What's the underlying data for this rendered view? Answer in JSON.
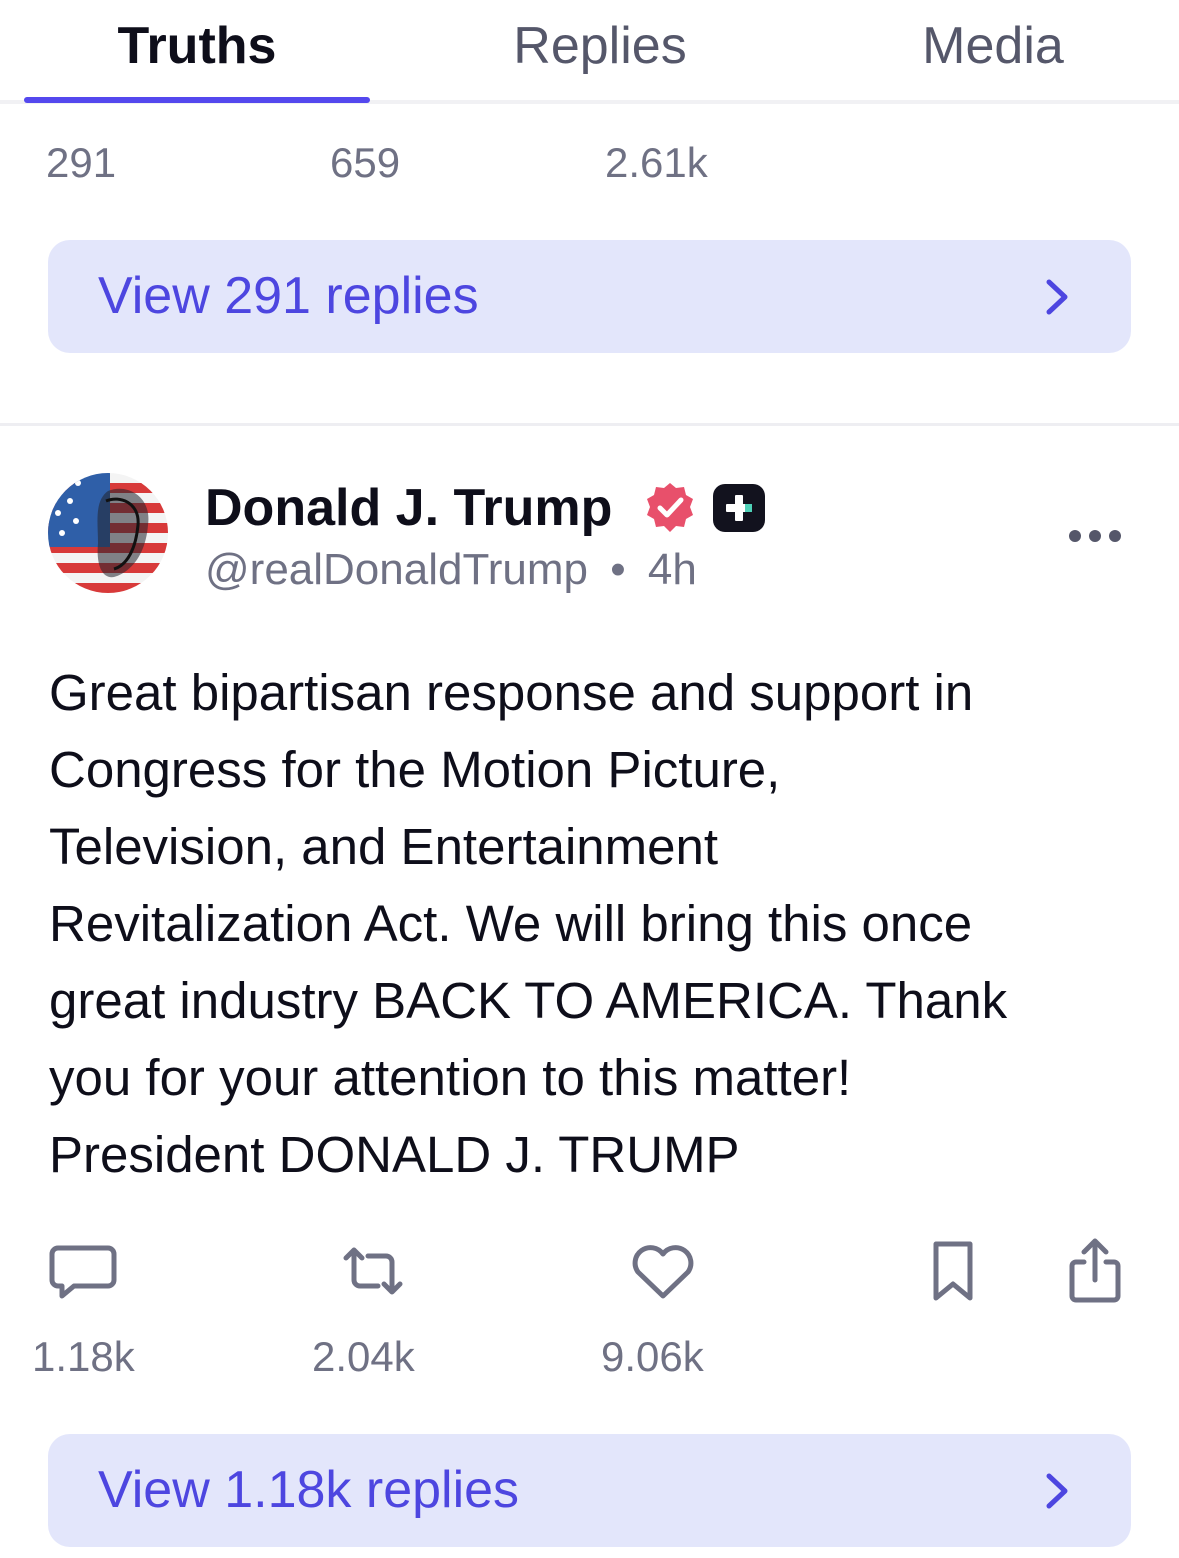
{
  "tabs": {
    "items": [
      {
        "label": "Truths",
        "active": true
      },
      {
        "label": "Replies",
        "active": false
      },
      {
        "label": "Media",
        "active": false
      }
    ],
    "accent_color": "#5448ee"
  },
  "previous_post": {
    "counts": [
      "291",
      "659",
      "2.61k"
    ],
    "view_replies_label": "View 291 replies"
  },
  "post": {
    "author": {
      "display_name": "Donald J. Trump",
      "handle": "@realDonaldTrump",
      "separator": "•",
      "time_ago": "4h",
      "verified_icon": "verified-badge-icon",
      "plus_icon": "truth-plus-icon"
    },
    "body": "Great bipartisan response and support in\nCongress for the Motion Picture,\nTelevision, and Entertainment\nRevitalization Act. We will bring this once\ngreat industry BACK TO AMERICA. Thank\nyou for your attention to this matter!\nPresident DONALD J. TRUMP",
    "actions": {
      "reply_count": "1.18k",
      "retruth_count": "2.04k",
      "like_count": "9.06k",
      "icons": [
        "reply-icon",
        "retruth-icon",
        "like-icon",
        "bookmark-icon",
        "share-icon"
      ]
    },
    "view_replies_label": "View 1.18k replies"
  },
  "colors": {
    "accent": "#5448ee",
    "reply_bar_bg": "#e3e6fb",
    "reply_bar_text": "#4d46e0",
    "verified": "#e8506b",
    "muted_text": "#6f7184"
  }
}
